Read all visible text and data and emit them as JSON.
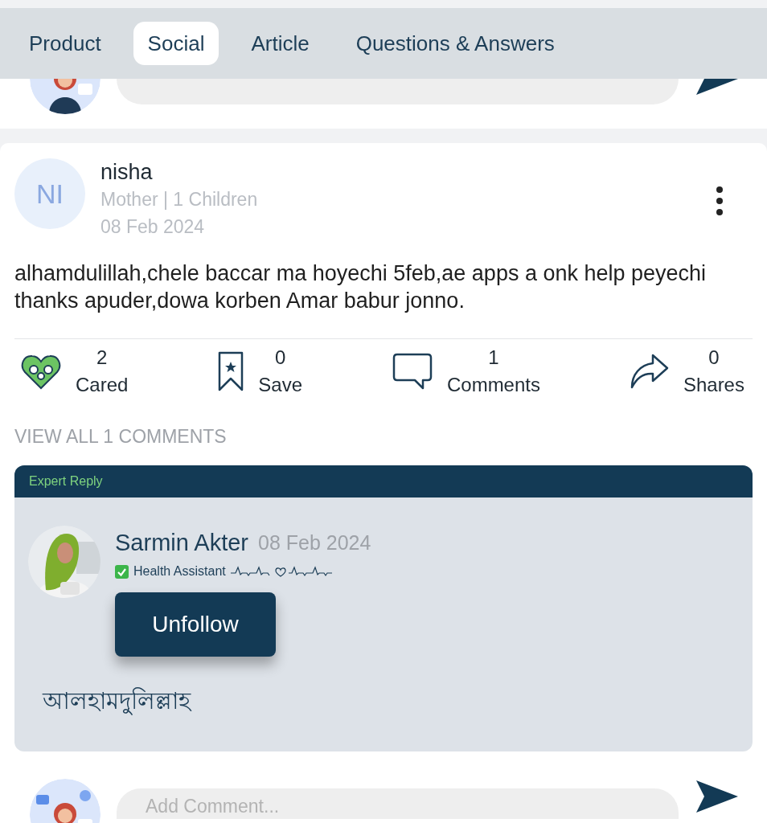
{
  "tabs": [
    {
      "label": "Product",
      "selected": false
    },
    {
      "label": "Social",
      "selected": true
    },
    {
      "label": "Article",
      "selected": false
    },
    {
      "label": "Questions & Answers",
      "selected": false
    }
  ],
  "post": {
    "initials": "NI",
    "author": "nisha",
    "subtitle": "Mother | 1 Children",
    "date": "08 Feb 2024",
    "body": "alhamdulillah,chele baccar ma hoyechi 5feb,ae apps a onk help peyechi thanks apuder,dowa korben Amar babur jonno.",
    "stats": [
      {
        "kind": "cared",
        "count": "2",
        "label": "Cared"
      },
      {
        "kind": "save",
        "count": "0",
        "label": "Save"
      },
      {
        "kind": "comments",
        "count": "1",
        "label": "Comments"
      },
      {
        "kind": "shares",
        "count": "0",
        "label": "Shares"
      }
    ],
    "view_all": "VIEW ALL 1 COMMENTS",
    "expert_reply": {
      "header": "Expert Reply",
      "name": "Sarmin Akter",
      "date": "08 Feb 2024",
      "verified": true,
      "role": "Health Assistant",
      "button": "Unfollow",
      "text": "আলহামদুলিল্লাহ"
    }
  },
  "composer": {
    "placeholder": "Add Comment..."
  }
}
